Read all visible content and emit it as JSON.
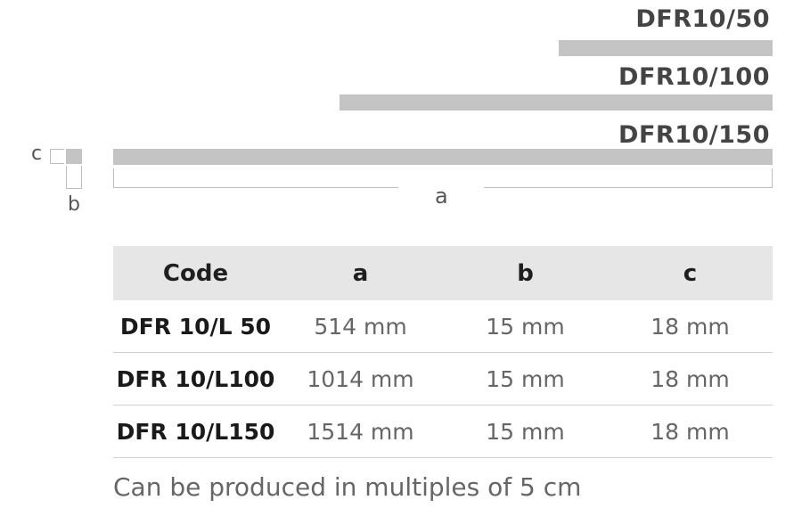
{
  "products": {
    "labels": [
      "DFR10/50",
      "DFR10/100",
      "DFR10/150"
    ]
  },
  "dimensions": {
    "a_label": "a",
    "b_label": "b",
    "c_label": "c"
  },
  "table": {
    "headers": [
      "Code",
      "a",
      "b",
      "c"
    ],
    "rows": [
      [
        "DFR 10/L 50",
        "514 mm",
        "15 mm",
        "18 mm"
      ],
      [
        "DFR 10/L100",
        "1014 mm",
        "15 mm",
        "18 mm"
      ],
      [
        "DFR 10/L150",
        "1514 mm",
        "15 mm",
        "18 mm"
      ]
    ]
  },
  "footnote": "Can be produced in multiples of 5 cm"
}
